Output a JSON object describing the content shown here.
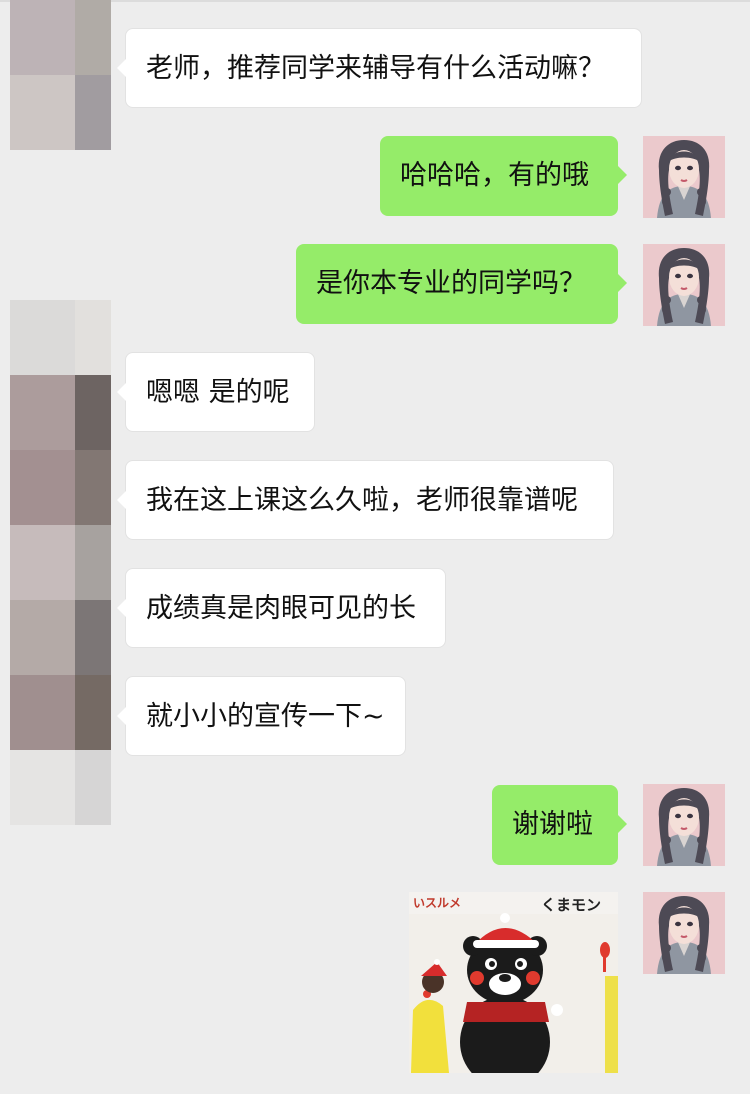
{
  "chat": {
    "messages": [
      {
        "side": "in",
        "text": "老师，推荐同学来辅导有什么活动嘛？"
      },
      {
        "side": "out",
        "text": "哈哈哈，有的哦"
      },
      {
        "side": "out",
        "text": "是你本专业的同学吗？"
      },
      {
        "side": "in",
        "text": "嗯嗯 是的呢"
      },
      {
        "side": "in",
        "text": "我在这上课这么久啦，老师很靠谱呢"
      },
      {
        "side": "in",
        "text": "成绩真是肉眼可见的长"
      },
      {
        "side": "in",
        "text": "就小小的宣传一下~"
      },
      {
        "side": "out",
        "text": "谢谢啦"
      }
    ],
    "sticker": {
      "banner_left": "いスルメ",
      "banner_right": "くまモン"
    }
  },
  "colors": {
    "background": "#ededed",
    "incoming_bubble": "#ffffff",
    "outgoing_bubble": "#95ec69",
    "text": "#111111"
  },
  "icons": {
    "left_avatar": "blurred-mosaic-avatar",
    "right_avatar": "illustrated-girl-avatar",
    "sticker": "kumamon-bear-sticker"
  }
}
